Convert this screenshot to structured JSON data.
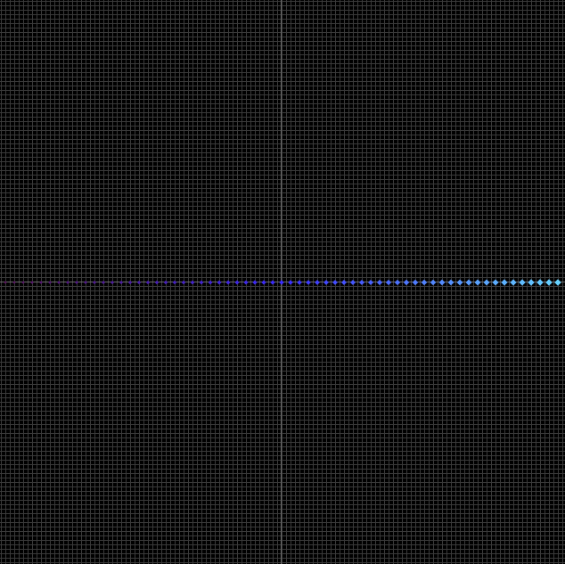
{
  "canvas": {
    "background": "#000000",
    "grid_color": "#3a3a3a",
    "axis_color": "#6b6b6b",
    "grid_on": true
  },
  "chart_data": {
    "type": "scatter",
    "title": "",
    "xlabel": "",
    "ylabel": "",
    "xlim": [
      -63,
      63
    ],
    "ylim": [
      -63,
      63
    ],
    "grid_step": 1,
    "series": [
      {
        "marker": "diamond",
        "color_start": "#5a1060",
        "color_mid": "#3a2cff",
        "color_end": "#66d2ff",
        "x_start": -62,
        "x_end": 62,
        "x_step": 2,
        "y": -0.2
      }
    ]
  }
}
